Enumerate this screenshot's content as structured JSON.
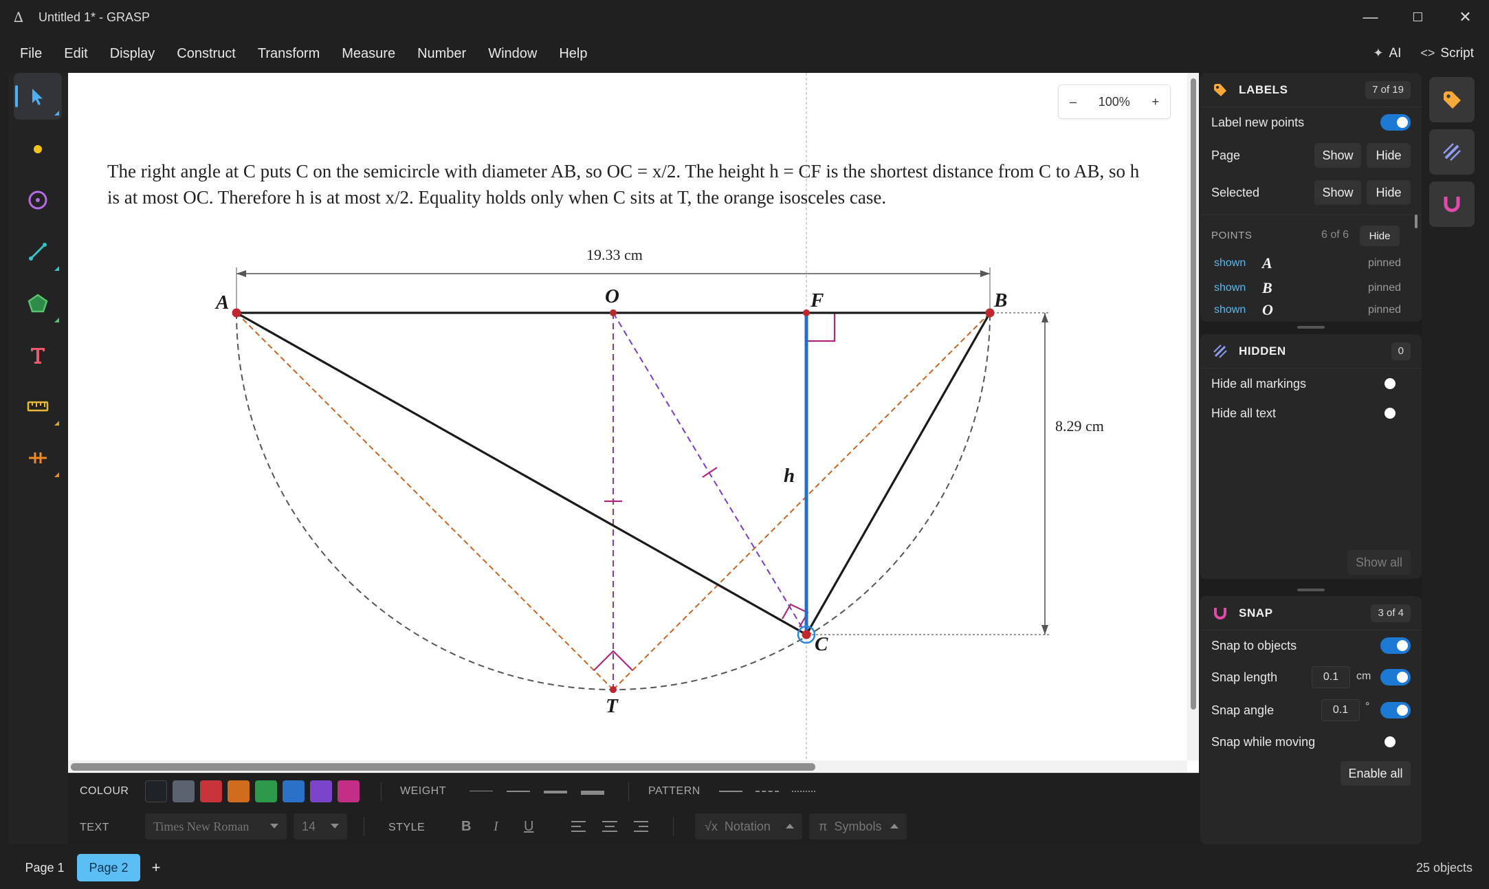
{
  "window": {
    "title": "Untitled 1* - GRASP",
    "minimize": "—",
    "maximize": "☐",
    "close": "✕"
  },
  "menu": {
    "items": [
      "File",
      "Edit",
      "Display",
      "Construct",
      "Transform",
      "Measure",
      "Number",
      "Window",
      "Help"
    ],
    "ai_label": "AI",
    "script_label": "Script"
  },
  "tools": [
    "select-tool",
    "point-tool",
    "circle-tool",
    "line-tool",
    "polygon-tool",
    "text-tool",
    "measure-tool",
    "marker-tool"
  ],
  "canvas": {
    "prose": "The right angle at C puts C on the semicircle with diameter AB, so OC = x/2. The height h = CF is the shortest distance from C to AB, so h is at most OC. Therefore h is at most x/2. Equality holds only when C sits at T, the orange isosceles case.",
    "zoom": {
      "minus": "–",
      "value": "100%",
      "plus": "+"
    },
    "labels": {
      "A": "A",
      "O": "O",
      "F": "F",
      "B": "B",
      "C": "C",
      "T": "T",
      "h": "h"
    },
    "dim_width": "19.33 cm",
    "dim_height": "8.29 cm"
  },
  "format": {
    "colour_label": "COLOUR",
    "swatches": [
      "#1f2328",
      "#5b6270",
      "#c8323a",
      "#cf6c1e",
      "#2c9a4a",
      "#2a71c8",
      "#7a45c8",
      "#c32e86"
    ],
    "weight_label": "WEIGHT",
    "pattern_label": "PATTERN",
    "text_label": "TEXT",
    "font_value": "Times New Roman",
    "size_value": "14",
    "style_label": "STYLE",
    "bold": "B",
    "italic": "I",
    "underline": "U",
    "notation_label": "Notation",
    "notation_icon": "√x",
    "symbols_label": "Symbols",
    "symbols_icon": "π"
  },
  "pages": {
    "tabs": [
      "Page 1",
      "Page 2"
    ],
    "active": "Page 2",
    "add": "+",
    "object_count": "25 objects"
  },
  "labels_panel": {
    "title": "LABELS",
    "badge": "7 of 19",
    "label_new_points": "Label new points",
    "page_label": "Page",
    "selected_label": "Selected",
    "show": "Show",
    "hide": "Hide",
    "points_header": "POINTS",
    "points_count": "6 of 6",
    "points_hide": "Hide",
    "points": [
      {
        "state": "shown",
        "name": "A",
        "status": "pinned"
      },
      {
        "state": "shown",
        "name": "B",
        "status": "pinned"
      },
      {
        "state": "shown",
        "name": "O",
        "status": "pinned"
      }
    ]
  },
  "hidden_panel": {
    "title": "HIDDEN",
    "badge": "0",
    "hide_all_markings": "Hide all markings",
    "hide_all_text": "Hide all text",
    "show_all": "Show all"
  },
  "snap_panel": {
    "title": "SNAP",
    "badge": "3 of 4",
    "snap_to_objects": "Snap to objects",
    "snap_length": "Snap length",
    "snap_length_value": "0.1",
    "snap_length_unit": "cm",
    "snap_angle": "Snap angle",
    "snap_angle_value": "0.1",
    "snap_angle_unit": "°",
    "snap_while_moving": "Snap while moving",
    "enable_all": "Enable all"
  },
  "colors": {
    "accent": "#4cb0f2",
    "toggle_on": "#1d7ad4",
    "orange_dash": "#c8641e",
    "purple_dash": "#7a3cc8",
    "height_blue": "#1f6fd0",
    "point_red": "#c0262d",
    "magenta_mark": "#b0267a"
  }
}
